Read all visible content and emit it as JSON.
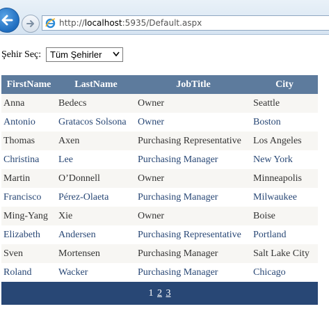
{
  "browser": {
    "url_prefix": "http://",
    "url_host": "localhost",
    "url_rest": ":5935/Default.aspx"
  },
  "filter": {
    "label": "Şehir Seç:",
    "selected": "Tüm Şehirler"
  },
  "grid": {
    "headers": [
      "FirstName",
      "LastName",
      "JobTitle",
      "City"
    ],
    "rows": [
      [
        "Anna",
        "Bedecs",
        "Owner",
        "Seattle"
      ],
      [
        "Antonio",
        "Gratacos Solsona",
        "Owner",
        "Boston"
      ],
      [
        "Thomas",
        "Axen",
        "Purchasing Representative",
        "Los Angeles"
      ],
      [
        "Christina",
        "Lee",
        "Purchasing Manager",
        "New York"
      ],
      [
        "Martin",
        "O’Donnell",
        "Owner",
        "Minneapolis"
      ],
      [
        "Francisco",
        "Pérez-Olaeta",
        "Purchasing Manager",
        "Milwaukee"
      ],
      [
        "Ming-Yang",
        "Xie",
        "Owner",
        "Boise"
      ],
      [
        "Elizabeth",
        "Andersen",
        "Purchasing Representative",
        "Portland"
      ],
      [
        "Sven",
        "Mortensen",
        "Purchasing Manager",
        "Salt Lake City"
      ],
      [
        "Roland",
        "Wacker",
        "Purchasing Manager",
        "Chicago"
      ]
    ]
  },
  "pager": {
    "current": "1",
    "pages": [
      "2",
      "3"
    ]
  },
  "colors": {
    "header_bg": "#5d7b9d",
    "pager_bg": "#284775",
    "alt_row_bg": "#f7f6f3"
  }
}
